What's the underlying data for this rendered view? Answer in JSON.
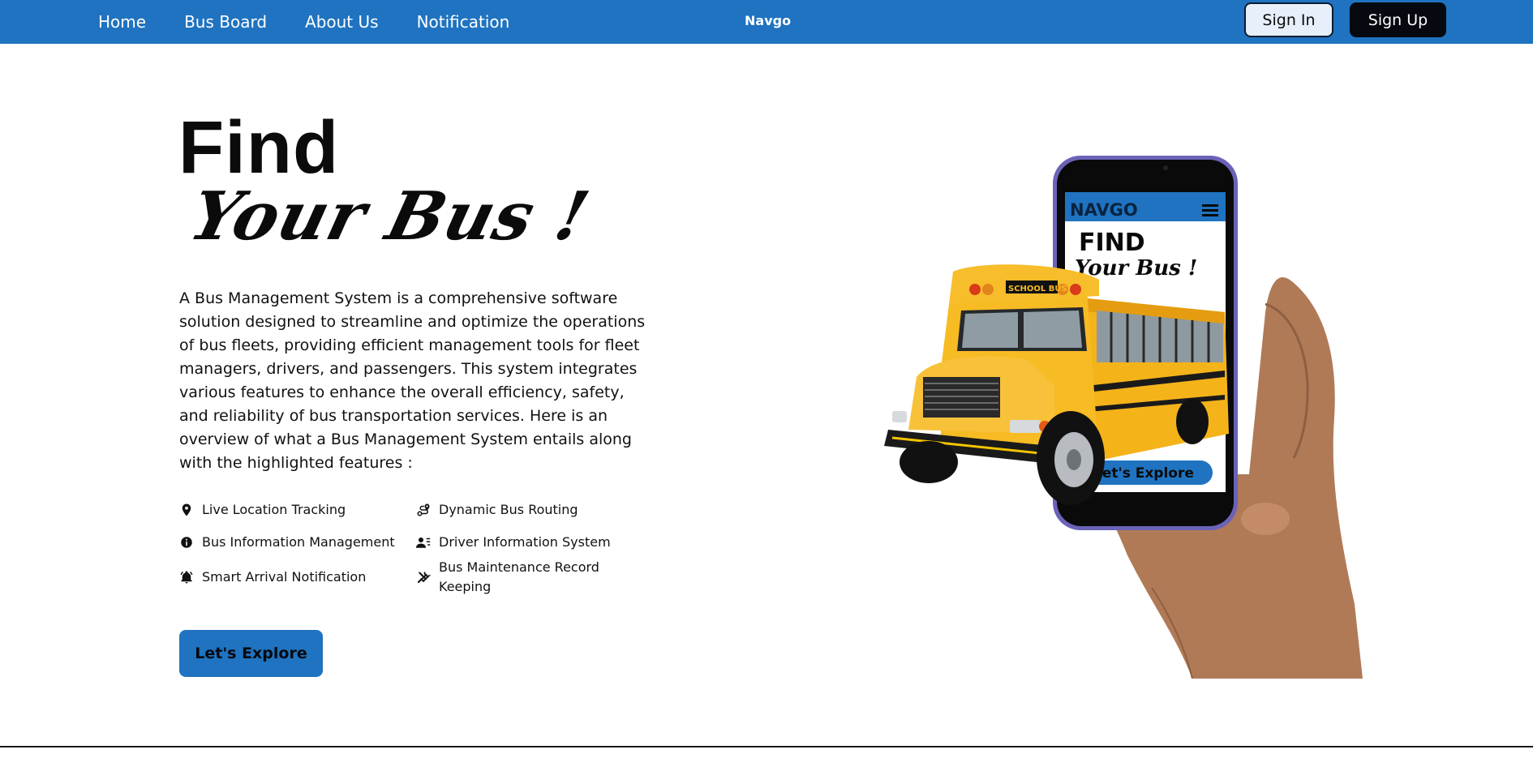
{
  "nav": {
    "links": [
      "Home",
      "Bus Board",
      "About Us",
      "Notification"
    ],
    "brand": "Navgo",
    "signin": "Sign In",
    "signup": "Sign Up"
  },
  "hero": {
    "title_line1": "Find",
    "title_line2": "Your Bus !",
    "description": "A Bus Management System is a comprehensive software solution designed to streamline and optimize the operations of bus fleets, providing efficient management tools for fleet managers, drivers, and passengers. This system integrates various features to enhance the overall efficiency, safety, and reliability of bus transportation services. Here is an overview of what a Bus Management System entails along with the highlighted features :",
    "features": [
      {
        "label": "Live Location Tracking",
        "icon": "location-pin-icon"
      },
      {
        "label": "Dynamic Bus Routing",
        "icon": "route-icon"
      },
      {
        "label": "Bus Information Management",
        "icon": "info-icon"
      },
      {
        "label": "Driver Information System",
        "icon": "user-list-icon"
      },
      {
        "label": "Smart Arrival Notification",
        "icon": "bell-icon"
      },
      {
        "label": "Bus Maintenance Record Keeping",
        "icon": "tools-icon"
      }
    ],
    "explore_button": "Let's Explore"
  },
  "illustration": {
    "phone_brand": "NAVGO",
    "phone_title1": "FIND",
    "phone_title2": "Your Bus !",
    "phone_button": "Let's Explore",
    "bus_sign": "SCHOOL BUS"
  },
  "colors": {
    "primary": "#1f73c0",
    "dark": "#06090f",
    "signin_bg": "#e6effa"
  }
}
